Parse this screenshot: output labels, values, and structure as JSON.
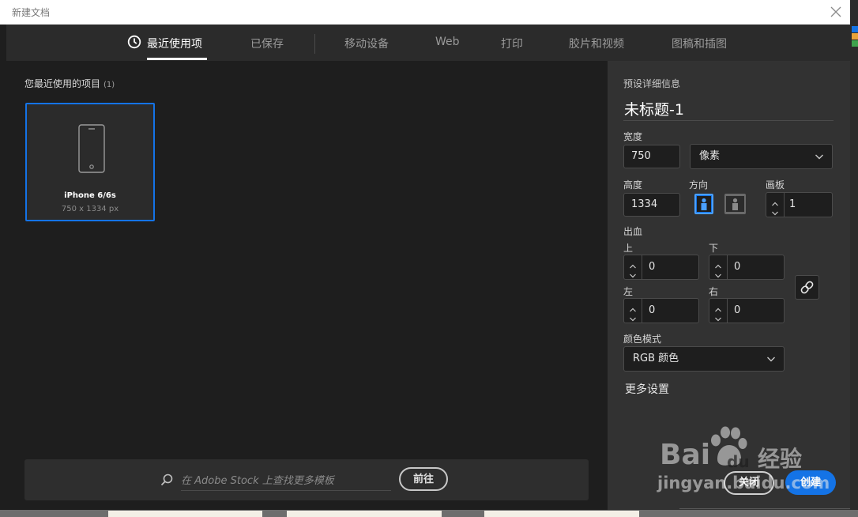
{
  "window": {
    "title": "新建文档"
  },
  "tabs": [
    {
      "label": "最近使用项",
      "active": true
    },
    {
      "label": "已保存"
    },
    {
      "label": "移动设备"
    },
    {
      "label": "Web"
    },
    {
      "label": "打印"
    },
    {
      "label": "胶片和视频"
    },
    {
      "label": "图稿和插图"
    }
  ],
  "recent": {
    "heading": "您最近使用的项目",
    "count": "(1)",
    "items": [
      {
        "name": "iPhone 6/6s",
        "size": "750 x 1334 px"
      }
    ]
  },
  "stock": {
    "placeholder": "在 Adobe Stock 上查找更多模板",
    "go_label": "前往"
  },
  "preset": {
    "heading": "预设详细信息",
    "name": "未标题-1",
    "width_label": "宽度",
    "width": "750",
    "unit": "像素",
    "height_label": "高度",
    "height": "1334",
    "orientation_label": "方向",
    "artboards_label": "画板",
    "artboards": "1",
    "bleed_label": "出血",
    "bleed_top_label": "上",
    "bleed_top": "0",
    "bleed_bottom_label": "下",
    "bleed_bottom": "0",
    "bleed_left_label": "左",
    "bleed_left": "0",
    "bleed_right_label": "右",
    "bleed_right": "0",
    "color_mode_label": "颜色模式",
    "color_mode": "RGB 颜色",
    "more_settings": "更多设置"
  },
  "actions": {
    "close_label": "关闭",
    "create_label": "创建"
  },
  "watermark": {
    "brand": "Bai",
    "brand2": "du",
    "site_cn": "经验",
    "url": "jingyan.baidu.com"
  },
  "colors": {
    "accent": "#1473e6",
    "panel": "#323232",
    "canvas": "#1e1e1e",
    "tabbar": "#2b2b2b"
  },
  "icons": [
    "clock-icon",
    "phone-icon",
    "search-icon",
    "chevron-down-icon",
    "portrait-icon",
    "landscape-icon",
    "link-icon",
    "close-icon"
  ]
}
